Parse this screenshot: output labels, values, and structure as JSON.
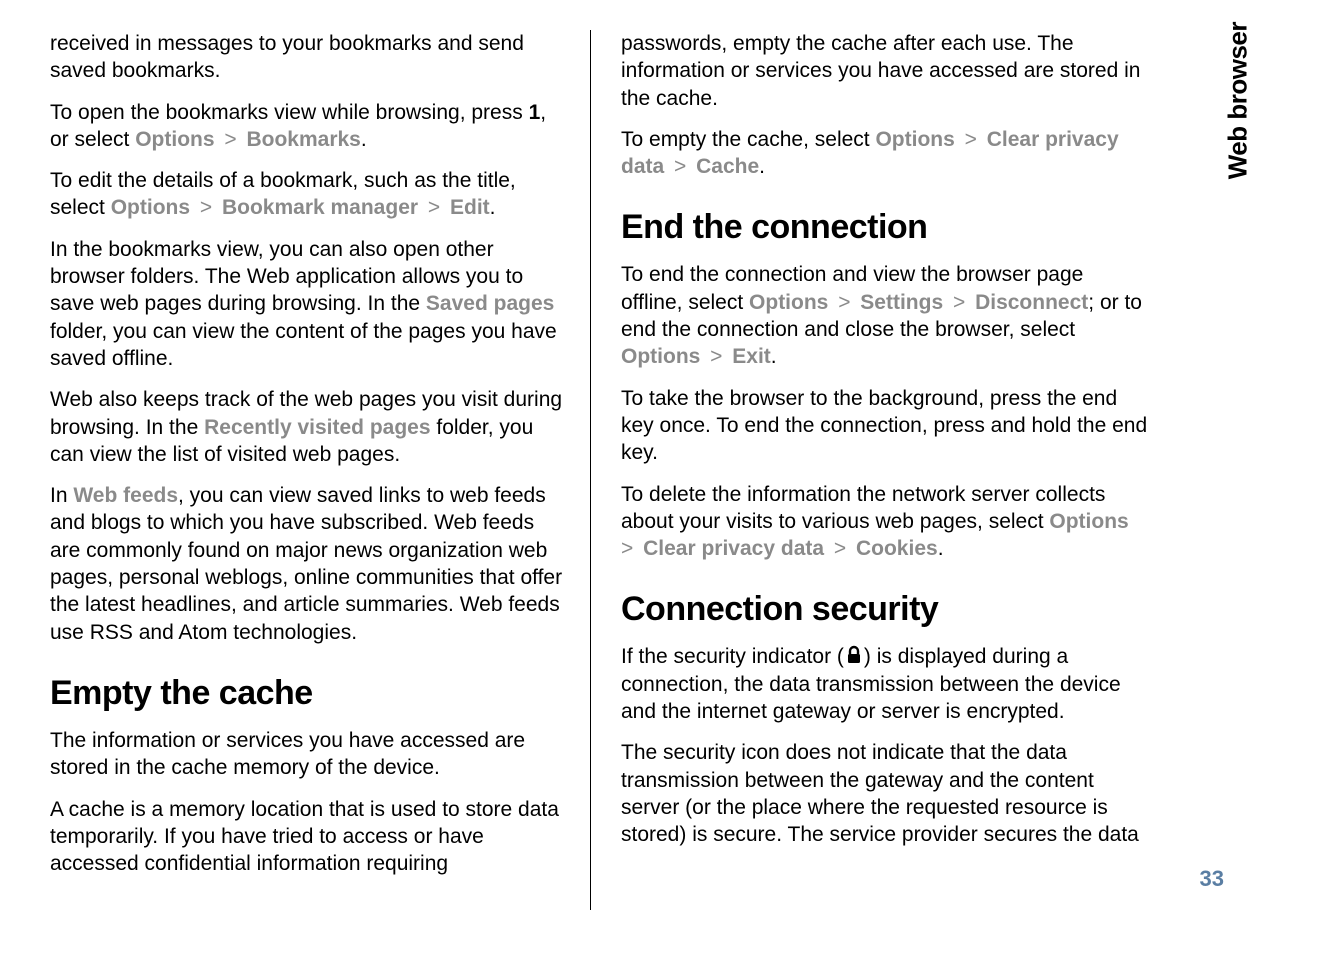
{
  "side_tab": "Web browser",
  "page_number": "33",
  "left": {
    "p1": {
      "t1": "received in messages to your bookmarks and send saved bookmarks."
    },
    "p2": {
      "t1": "To open the bookmarks view while browsing, press ",
      "b1": "1",
      "t2": ", or select ",
      "m1": "Options",
      "t3": " > ",
      "m2": "Bookmarks",
      "t4": "."
    },
    "p3": {
      "t1": "To edit the details of a bookmark, such as the title, select ",
      "m1": "Options",
      "t2": " > ",
      "m2": "Bookmark manager",
      "t3": " > ",
      "m3": "Edit",
      "t4": "."
    },
    "p4": {
      "t1": "In the bookmarks view, you can also open other browser folders. The Web application allows you to save web pages during browsing. In the ",
      "m1": "Saved pages",
      "t2": " folder, you can view the content of the pages you have saved offline."
    },
    "p5": {
      "t1": "Web also keeps track of the web pages you visit during browsing. In the ",
      "m1": "Recently visited pages",
      "t2": " folder, you can view the list of visited web pages."
    },
    "p6": {
      "t1": "In ",
      "m1": "Web feeds",
      "t2": ", you can view saved links to web feeds and blogs to which you have subscribed. Web feeds are commonly found on major news organization web pages, personal weblogs, online communities that offer the latest headlines, and article summaries. Web feeds use RSS and Atom technologies."
    },
    "h1": "Empty the cache",
    "p7": {
      "t1": "The information or services you have accessed are stored in the cache memory of the device."
    },
    "p8": {
      "t1": "A cache is a memory location that is used to store data temporarily. If you have tried to access or have accessed confidential information requiring"
    }
  },
  "right": {
    "p1": {
      "t1": "passwords, empty the cache after each use. The information or services you have accessed are stored in the cache."
    },
    "p2": {
      "t1": "To empty the cache, select ",
      "m1": "Options",
      "t2": " > ",
      "m2": "Clear privacy data",
      "t3": " > ",
      "m3": "Cache",
      "t4": "."
    },
    "h1": "End the connection",
    "p3": {
      "t1": "To end the connection and view the browser page offline, select ",
      "m1": "Options",
      "t2": " > ",
      "m2": "Settings",
      "t3": " > ",
      "m3": "Disconnect",
      "t4": "; or to end the connection and close the browser, select ",
      "m4": "Options",
      "t5": " > ",
      "m5": "Exit",
      "t6": "."
    },
    "p4": {
      "t1": "To take the browser to the background, press the end key once. To end the connection, press and hold the end key."
    },
    "p5": {
      "t1": "To delete the information the network server collects about your visits to various web pages, select ",
      "m1": "Options",
      "t2": " > ",
      "m2": "Clear privacy data",
      "t3": " > ",
      "m3": "Cookies",
      "t4": "."
    },
    "h2": "Connection security",
    "p6": {
      "t1": "If the security indicator (",
      "t2": ") is displayed during a connection, the data transmission between the device and the internet gateway or server is encrypted."
    },
    "p7": {
      "t1": "The security icon does not indicate that the data transmission between the gateway and the content server (or the place where the requested resource is stored) is secure. The service provider secures the data"
    }
  }
}
